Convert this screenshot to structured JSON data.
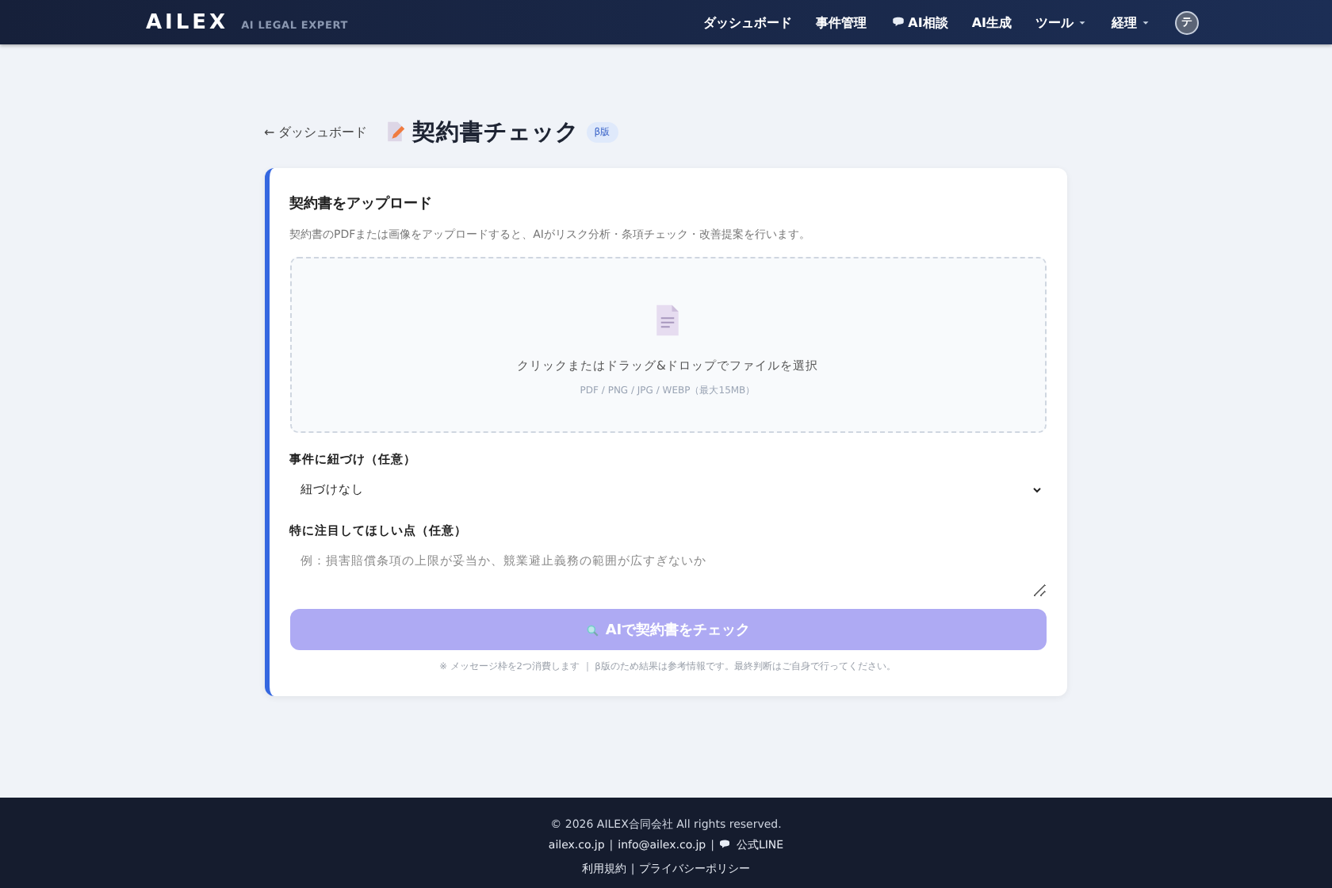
{
  "header": {
    "logo": "AILEX",
    "tagline": "AI LEGAL EXPERT",
    "nav": [
      {
        "label": "ダッシュボード",
        "kind": "plain",
        "dropdown": false
      },
      {
        "label": "事件管理",
        "kind": "plain",
        "dropdown": false
      },
      {
        "label": "AI相談",
        "kind": "chat",
        "dropdown": false
      },
      {
        "label": "AI生成",
        "kind": "plain",
        "dropdown": false
      },
      {
        "label": "ツール",
        "kind": "plain",
        "dropdown": true
      },
      {
        "label": "経理",
        "kind": "plain",
        "dropdown": true
      }
    ],
    "avatar": "テ"
  },
  "page": {
    "back": "← ダッシュボード",
    "title": "契約書チェック",
    "badge": "β版"
  },
  "card": {
    "heading": "契約書をアップロード",
    "description": "契約書のPDFまたは画像をアップロードすると、AIがリスク分析・条項チェック・改善提案を行います。",
    "dropzone": {
      "prompt": "クリックまたはドラッグ&ドロップでファイルを選択",
      "formats": "PDF / PNG / JPG / WEBP（最大15MB）"
    },
    "case_label": "事件に紐づけ（任意）",
    "case_value": "紐づけなし",
    "focus_label": "特に注目してほしい点（任意）",
    "focus_placeholder": "例：損害賠償条項の上限が妥当か、競業避止義務の範囲が広すぎないか",
    "submit": {
      "label": "AIで契約書をチェック",
      "disabled": true
    },
    "note": "※ メッセージ枠を2つ消費します ｜ β版のため結果は参考情報です。最終判断はご自身で行ってください。"
  },
  "footer": {
    "copyright": "© 2026 AILEX合同会社 All rights reserved.",
    "separator": "|",
    "links": [
      {
        "label": "ailex.co.jp",
        "kind": "plain"
      },
      {
        "label": "info@ailex.co.jp",
        "kind": "plain"
      },
      {
        "label": "公式LINE",
        "kind": "chat"
      }
    ],
    "legal": [
      {
        "label": "利用規約"
      },
      {
        "label": "プライバシーポリシー"
      }
    ]
  }
}
